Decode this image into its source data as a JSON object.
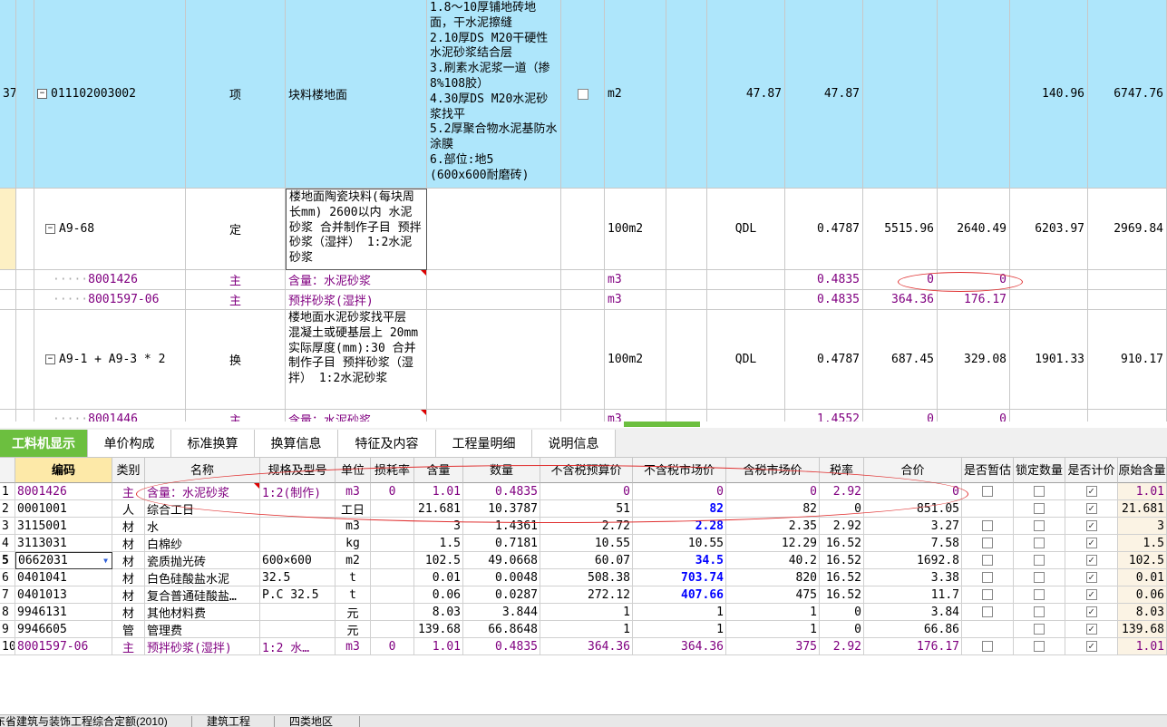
{
  "upper_rows": [
    {
      "no": "37",
      "code": "011102003002",
      "type": "项",
      "name": "块料楼地面",
      "desc": "1.8～10厚铺地砖地面，干水泥擦缝\n2.10厚DS M20干硬性水泥砂浆结合层\n3.刷素水泥浆一道（掺8%108胶）\n4.30厚DS M20水泥砂浆找平\n5.2厚聚合物水泥基防水涂膜\n6.部位:地5\n(600x600耐磨砖)",
      "unit": "m2",
      "qty_expr": "47.87",
      "qty": "47.87",
      "price": "",
      "price2": "",
      "total1": "140.96",
      "total2": "6747.76"
    },
    {
      "code": "A9-68",
      "type": "定",
      "name": "楼地面陶瓷块料(每块周长mm) 2600以内 水泥砂浆  合并制作子目 预拌砂浆（湿拌） 1:2水泥砂浆",
      "unit": "100m2",
      "qty_expr": "QDL",
      "qty": "0.4787",
      "price": "5515.96",
      "price2": "2640.49",
      "total1": "6203.97",
      "total2": "2969.84"
    },
    {
      "code": "8001426",
      "type": "主",
      "name": "含量：水泥砂浆",
      "unit": "m3",
      "qty": "0.4835",
      "price": "0",
      "price2": "0"
    },
    {
      "code": "8001597-06",
      "type": "主",
      "name": "预拌砂浆(湿拌)",
      "unit": "m3",
      "qty": "0.4835",
      "price": "364.36",
      "price2": "176.17"
    },
    {
      "code": "A9-1 + A9-3 * 2",
      "type": "换",
      "name": "楼地面水泥砂浆找平层 混凝土或硬基层上 20mm  实际厚度(mm):30  合并制作子目 预拌砂浆（湿拌） 1:2水泥砂浆",
      "unit": "100m2",
      "qty_expr": "QDL",
      "qty": "0.4787",
      "price": "687.45",
      "price2": "329.08",
      "total1": "1901.33",
      "total2": "910.17"
    },
    {
      "code": "8001446",
      "type": "主",
      "name": "含量：水泥砂浆",
      "unit": "m3",
      "qty": "1.4552",
      "price": "0",
      "price2": "0"
    }
  ],
  "tabs": [
    "工料机显示",
    "单价构成",
    "标准换算",
    "换算信息",
    "特征及内容",
    "工程量明细",
    "说明信息"
  ],
  "headers": [
    "",
    "编码",
    "类别",
    "名称",
    "规格及型号",
    "单位",
    "损耗率",
    "含量",
    "数量",
    "不含税预算价",
    "不含税市场价",
    "含税市场价",
    "税率",
    "合价",
    "是否暂估",
    "锁定数量",
    "是否计价",
    "原始含量"
  ],
  "rows": [
    {
      "n": "1",
      "code": "8001426",
      "cat": "主",
      "name": "含量：水泥砂浆",
      "spec": "1:2(制作)",
      "unit": "m3",
      "loss": "0",
      "content": "1.01",
      "qty": "0.4835",
      "p1": "0",
      "p2": "0",
      "p3": "0",
      "tax": "2.92",
      "total": "0",
      "est": false,
      "lock": false,
      "priced": true,
      "orig": "1.01",
      "purple": true
    },
    {
      "n": "2",
      "code": "0001001",
      "cat": "人",
      "name": "综合工日",
      "spec": "",
      "unit": "工日",
      "loss": "",
      "content": "21.681",
      "qty": "10.3787",
      "p1": "51",
      "p2": "82",
      "p3": "82",
      "tax": "0",
      "total": "851.05",
      "est": null,
      "lock": false,
      "priced": true,
      "orig": "21.681",
      "purple": false
    },
    {
      "n": "3",
      "code": "3115001",
      "cat": "材",
      "name": "水",
      "spec": "",
      "unit": "m3",
      "loss": "",
      "content": "3",
      "qty": "1.4361",
      "p1": "2.72",
      "p2": "2.28",
      "p3": "2.35",
      "tax": "2.92",
      "total": "3.27",
      "est": false,
      "lock": false,
      "priced": true,
      "orig": "3",
      "purple": false
    },
    {
      "n": "4",
      "code": "3113031",
      "cat": "材",
      "name": "白棉纱",
      "spec": "",
      "unit": "kg",
      "loss": "",
      "content": "1.5",
      "qty": "0.7181",
      "p1": "10.55",
      "p2": "10.55",
      "p3": "12.29",
      "tax": "16.52",
      "total": "7.58",
      "est": false,
      "lock": false,
      "priced": true,
      "orig": "1.5",
      "purple": false
    },
    {
      "n": "5",
      "code": "0662031",
      "cat": "材",
      "name": "瓷质抛光砖",
      "spec": "600×600",
      "unit": "m2",
      "loss": "",
      "content": "102.5",
      "qty": "49.0668",
      "p1": "60.07",
      "p2": "34.5",
      "p3": "40.2",
      "tax": "16.52",
      "total": "1692.8",
      "est": false,
      "lock": false,
      "priced": true,
      "orig": "102.5",
      "purple": false
    },
    {
      "n": "6",
      "code": "0401041",
      "cat": "材",
      "name": "白色硅酸盐水泥",
      "spec": "32.5",
      "unit": "t",
      "loss": "",
      "content": "0.01",
      "qty": "0.0048",
      "p1": "508.38",
      "p2": "703.74",
      "p3": "820",
      "tax": "16.52",
      "total": "3.38",
      "est": false,
      "lock": false,
      "priced": true,
      "orig": "0.01",
      "purple": false
    },
    {
      "n": "7",
      "code": "0401013",
      "cat": "材",
      "name": "复合普通硅酸盐…",
      "spec": "P.C 32.5",
      "unit": "t",
      "loss": "",
      "content": "0.06",
      "qty": "0.0287",
      "p1": "272.12",
      "p2": "407.66",
      "p3": "475",
      "tax": "16.52",
      "total": "11.7",
      "est": false,
      "lock": false,
      "priced": true,
      "orig": "0.06",
      "purple": false
    },
    {
      "n": "8",
      "code": "9946131",
      "cat": "材",
      "name": "其他材料费",
      "spec": "",
      "unit": "元",
      "loss": "",
      "content": "8.03",
      "qty": "3.844",
      "p1": "1",
      "p2": "1",
      "p3": "1",
      "tax": "0",
      "total": "3.84",
      "est": false,
      "lock": false,
      "priced": true,
      "orig": "8.03",
      "purple": false
    },
    {
      "n": "9",
      "code": "9946605",
      "cat": "管",
      "name": "管理费",
      "spec": "",
      "unit": "元",
      "loss": "",
      "content": "139.68",
      "qty": "66.8648",
      "p1": "1",
      "p2": "1",
      "p3": "1",
      "tax": "0",
      "total": "66.86",
      "est": null,
      "lock": false,
      "priced": true,
      "orig": "139.68",
      "purple": false
    },
    {
      "n": "10",
      "code": "8001597-06",
      "cat": "主",
      "name": "预拌砂浆(湿拌)",
      "spec": "1:2 水…",
      "unit": "m3",
      "loss": "0",
      "content": "1.01",
      "qty": "0.4835",
      "p1": "364.36",
      "p2": "364.36",
      "p3": "375",
      "tax": "2.92",
      "total": "176.17",
      "est": false,
      "lock": false,
      "priced": true,
      "orig": "1.01",
      "purple": true
    }
  ],
  "status": [
    "东省建筑与装饰工程综合定额(2010)",
    "建筑工程",
    "四类地区"
  ]
}
